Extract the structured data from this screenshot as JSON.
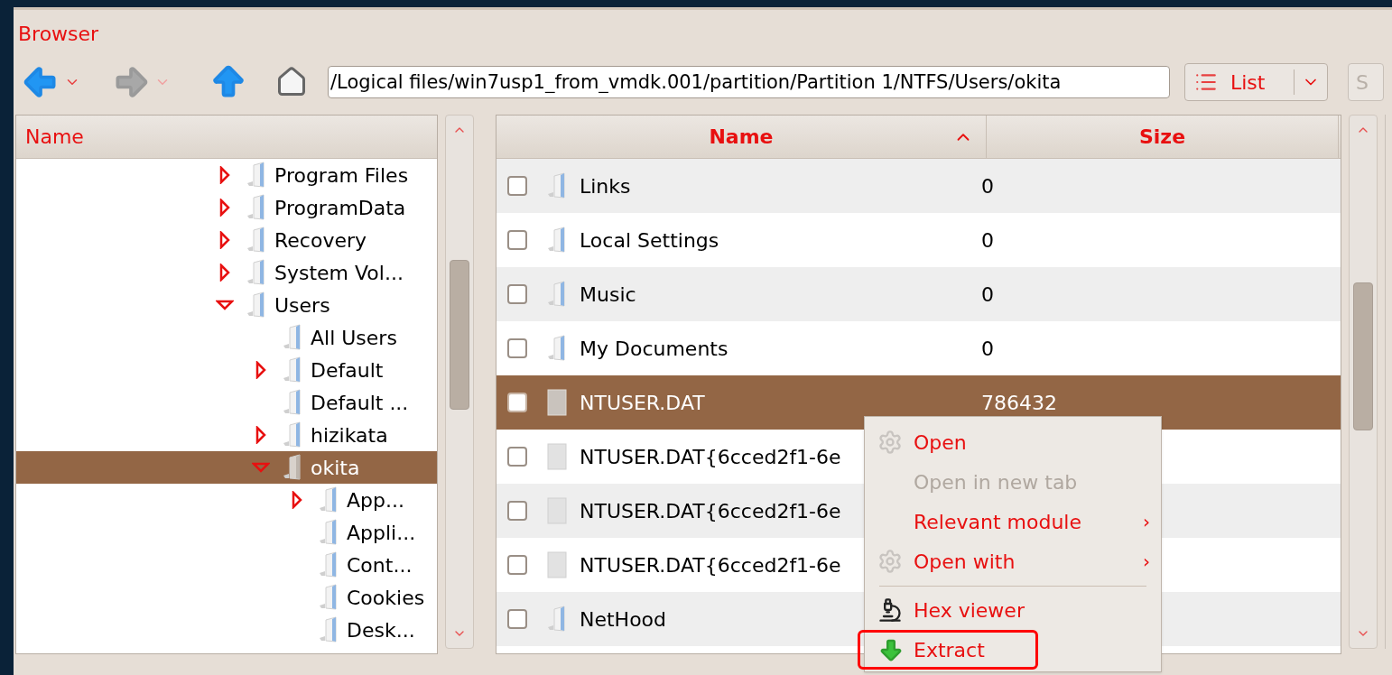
{
  "window": {
    "title": "Browser"
  },
  "toolbar": {
    "back": {
      "disabled": false
    },
    "forward": {
      "disabled": true
    },
    "path": "/Logical files/win7usp1_from_vmdk.001/partition/Partition 1/NTFS/Users/okita",
    "view_button": "List",
    "next_button": "S"
  },
  "tree": {
    "column": "Name",
    "items": [
      {
        "label": "Program Files",
        "kind": "collapsed",
        "selected": false
      },
      {
        "label": "ProgramData",
        "kind": "collapsed",
        "selected": false
      },
      {
        "label": "Recovery",
        "kind": "collapsed",
        "selected": false
      },
      {
        "label": "System Vol...",
        "kind": "collapsed",
        "selected": false
      },
      {
        "label": "Users",
        "kind": "expanded",
        "selected": false,
        "children": [
          {
            "label": "All Users",
            "kind": "leaf",
            "selected": false
          },
          {
            "label": "Default",
            "kind": "collapsed",
            "selected": false
          },
          {
            "label": "Default ...",
            "kind": "leaf",
            "selected": false
          },
          {
            "label": "hizikata",
            "kind": "collapsed",
            "selected": false
          },
          {
            "label": "okita",
            "kind": "expanded",
            "selected": true,
            "children": [
              {
                "label": "App...",
                "kind": "collapsed",
                "selected": false
              },
              {
                "label": "Appli...",
                "kind": "leaf",
                "selected": false
              },
              {
                "label": "Cont...",
                "kind": "leaf",
                "selected": false
              },
              {
                "label": "Cookies",
                "kind": "leaf",
                "selected": false
              },
              {
                "label": "Desk...",
                "kind": "leaf",
                "selected": false
              }
            ]
          }
        ]
      }
    ]
  },
  "files": {
    "columns": [
      {
        "label": "Name",
        "sorted": true
      },
      {
        "label": "Size",
        "sorted": false
      }
    ],
    "rows": [
      {
        "name": "Links",
        "size": "0",
        "kind": "folder",
        "checked": false,
        "selected": false
      },
      {
        "name": "Local Settings",
        "size": "0",
        "kind": "folder",
        "checked": false,
        "selected": false
      },
      {
        "name": "Music",
        "size": "0",
        "kind": "folder",
        "checked": false,
        "selected": false
      },
      {
        "name": "My Documents",
        "size": "0",
        "kind": "folder",
        "checked": false,
        "selected": false
      },
      {
        "name": "NTUSER.DAT",
        "size": "786432",
        "kind": "file",
        "checked": false,
        "selected": true
      },
      {
        "name": "NTUSER.DAT{6cced2f1-6e",
        "kind": "file",
        "checked": false,
        "selected": false
      },
      {
        "name": "NTUSER.DAT{6cced2f1-6e",
        "kind": "file",
        "checked": false,
        "selected": false
      },
      {
        "name": "NTUSER.DAT{6cced2f1-6e",
        "kind": "file",
        "checked": false,
        "selected": false
      },
      {
        "name": "NetHood",
        "kind": "folder",
        "checked": false,
        "selected": false
      }
    ]
  },
  "context_menu": [
    {
      "kind": "gear",
      "label": "Open",
      "disabled": false,
      "highlighted": false
    },
    {
      "kind": "plain",
      "label": "Open in new tab",
      "disabled": true,
      "highlighted": false
    },
    {
      "kind": "plain",
      "label": "Relevant module",
      "submenu_arrow": "›",
      "disabled": false,
      "highlighted": false
    },
    {
      "kind": "gear",
      "label": "Open with",
      "submenu_arrow": "›",
      "disabled": false,
      "highlighted": false
    },
    {
      "kind": "separator"
    },
    {
      "kind": "viewer",
      "label": "Hex viewer",
      "disabled": false,
      "highlighted": false
    },
    {
      "kind": "download",
      "label": "Extract",
      "disabled": false,
      "highlighted": true
    }
  ]
}
